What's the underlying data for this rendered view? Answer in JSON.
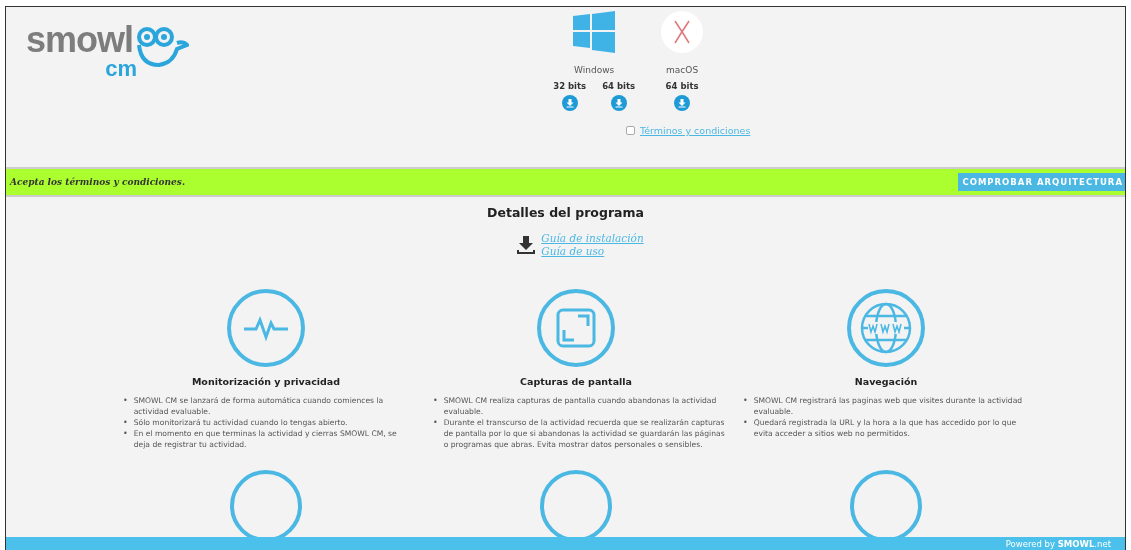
{
  "logo": {
    "word": "smowl",
    "sub": "cm"
  },
  "platforms": [
    {
      "name": "Windows",
      "builds": [
        "32 bits",
        "64 bits"
      ]
    },
    {
      "name": "macOS",
      "builds": [
        "64 bits"
      ]
    }
  ],
  "terms": {
    "label": "Términos y condiciones",
    "checked": false
  },
  "notice": {
    "message": "Acepta los términos y condiciones.",
    "button": "COMPROBAR ARQUITECTURA"
  },
  "details": {
    "title": "Detalles del programa",
    "links": [
      "Guía de instalación",
      "Guía de uso"
    ]
  },
  "bullet": "•",
  "features": [
    {
      "title": "Monitorización y privacidad",
      "points": [
        "SMOWL CM se lanzará de forma automática cuando comiences la actividad evaluable.",
        "Sólo monitorizará tu actividad cuando lo tengas abierto.",
        "En el momento en que terminas la actividad y cierras SMOWL CM, se deja de registrar tu actividad."
      ]
    },
    {
      "title": "Capturas de pantalla",
      "points": [
        "SMOWL CM realiza capturas de pantalla cuando abandonas la actividad evaluable.",
        "Durante el transcurso de la actividad recuerda que se realizarán capturas de pantalla por lo que si abandonas la actividad se guardarán las páginas o programas que abras. Evita mostrar datos personales o sensibles."
      ]
    },
    {
      "title": "Navegación",
      "points": [
        "SMOWL CM registrará las paginas web que visites durante la actividad evaluable.",
        "Quedará registrada la URL y la hora a la que has accedido por lo que evita acceder a sitios web no permitidos."
      ]
    }
  ],
  "footer": "Powered by **SMOWL**.net"
}
